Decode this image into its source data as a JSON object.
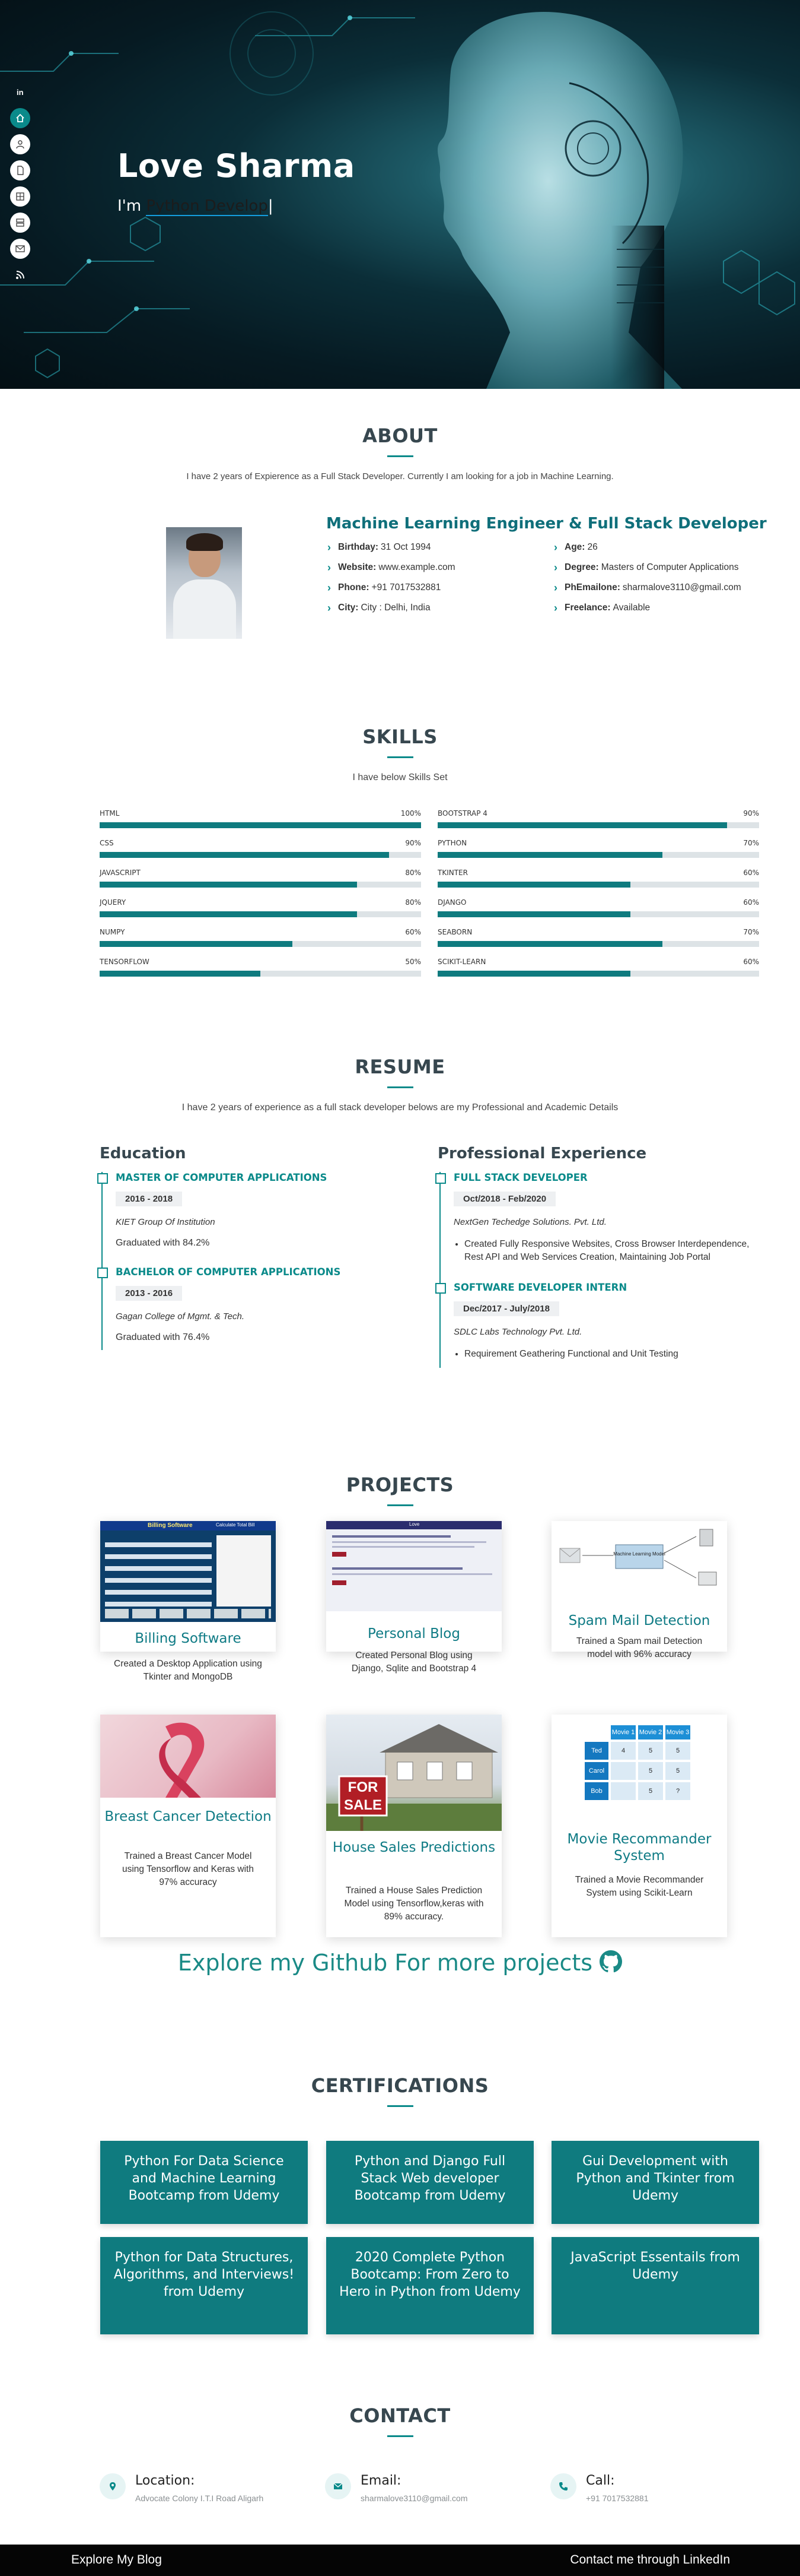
{
  "hero": {
    "name": "Love Sharma",
    "typed_prefix": "I'm",
    "typed_role": "Python Develop",
    "cursor": "|"
  },
  "nav": {
    "items": [
      {
        "icon": "linkedin-icon",
        "label": "in"
      },
      {
        "icon": "home-icon"
      },
      {
        "icon": "user-icon"
      },
      {
        "icon": "file-icon"
      },
      {
        "icon": "book-icon"
      },
      {
        "icon": "server-icon"
      },
      {
        "icon": "envelope-icon"
      },
      {
        "icon": "rss-icon"
      }
    ]
  },
  "about": {
    "title": "ABOUT",
    "intro": "I have 2 years of Expierence as a Full Stack Developer. Currently I am looking for a job in Machine Learning.",
    "role": "Machine Learning Engineer & Full Stack Developer",
    "left": [
      {
        "label": "Birthday:",
        "value": "31 Oct 1994"
      },
      {
        "label": "Website:",
        "value": "www.example.com"
      },
      {
        "label": "Phone:",
        "value": "+91 7017532881"
      },
      {
        "label": "City:",
        "value": "City : Delhi, India"
      }
    ],
    "right": [
      {
        "label": "Age:",
        "value": "26"
      },
      {
        "label": "Degree:",
        "value": "Masters of Computer Applications"
      },
      {
        "label": "PhEmailone:",
        "value": "sharmalove3110@gmail.com"
      },
      {
        "label": "Freelance:",
        "value": "Available"
      }
    ]
  },
  "skills": {
    "title": "SKILLS",
    "subtitle": "I have below Skills Set",
    "left": [
      {
        "name": "HTML",
        "pct": "100%",
        "value": 100
      },
      {
        "name": "CSS",
        "pct": "90%",
        "value": 90
      },
      {
        "name": "JAVASCRIPT",
        "pct": "80%",
        "value": 80
      },
      {
        "name": "JQUERY",
        "pct": "80%",
        "value": 80
      },
      {
        "name": "NUMPY",
        "pct": "60%",
        "value": 60
      },
      {
        "name": "TENSORFLOW",
        "pct": "50%",
        "value": 50
      }
    ],
    "right": [
      {
        "name": "BOOTSTRAP 4",
        "pct": "90%",
        "value": 90
      },
      {
        "name": "PYTHON",
        "pct": "70%",
        "value": 70
      },
      {
        "name": "TKINTER",
        "pct": "60%",
        "value": 60
      },
      {
        "name": "DJANGO",
        "pct": "60%",
        "value": 60
      },
      {
        "name": "SEABORN",
        "pct": "70%",
        "value": 70
      },
      {
        "name": "SCIKIT-LEARN",
        "pct": "60%",
        "value": 60
      }
    ]
  },
  "resume": {
    "title": "RESUME",
    "subtitle": "I have 2 years of experience as a full stack developer belows are my Professional and Academic Details",
    "education_title": "Education",
    "experience_title": "Professional Experience",
    "education": [
      {
        "title": "MASTER OF COMPUTER APPLICATIONS",
        "date": "2016 - 2018",
        "place": "KIET Group Of Institution",
        "note": "Graduated with 84.2%"
      },
      {
        "title": "BACHELOR OF COMPUTER APPLICATIONS",
        "date": "2013 - 2016",
        "place": "Gagan College of Mgmt. & Tech.",
        "note": "Graduated with 76.4%"
      }
    ],
    "experience": [
      {
        "title": "FULL STACK DEVELOPER",
        "date": "Oct/2018 - Feb/2020",
        "place": "NextGen Techedge Solutions. Pvt. Ltd.",
        "bullets": [
          "Created Fully Responsive Websites, Cross Browser Interdependence, Rest API and Web Services Creation, Maintaining Job Portal"
        ]
      },
      {
        "title": "SOFTWARE DEVELOPER INTERN",
        "date": "Dec/2017 - July/2018",
        "place": "SDLC Labs Technology Pvt. Ltd.",
        "bullets": [
          "Requirement Geathering Functional and Unit Testing"
        ]
      }
    ]
  },
  "projects": {
    "title": "PROJECTS",
    "items": [
      {
        "title": "Billing Software",
        "desc": "Created a Desktop Application using Tkinter and MongoDB",
        "thumb": "billing-thumb"
      },
      {
        "title": "Personal Blog",
        "desc": "Created Personal Blog using Django, Sqlite and Bootstrap 4",
        "thumb": "blog-thumb"
      },
      {
        "title": "Spam Mail Detection",
        "desc": "Trained a Spam mail Detection model with 96% accuracy",
        "thumb": "spam-thumb"
      },
      {
        "title": "Breast Cancer Detection",
        "desc": "Trained a Breast Cancer Model using Tensorflow and Keras with 97% accuracy",
        "thumb": "ribbon-thumb"
      },
      {
        "title": "House Sales Predictions",
        "desc": "Trained a House Sales Prediction Model using Tensorflow,keras with 89% accuracy.",
        "thumb": "house-thumb"
      },
      {
        "title": "Movie Recommander System",
        "desc": "Trained a Movie Recommander System using Scikit-Learn",
        "thumb": "movie-thumb"
      }
    ],
    "billing_thumb": {
      "title": "Billing Software",
      "right_title": "Calculate Total Bill"
    },
    "blog_thumb": {
      "header": "Love"
    },
    "house_thumb": {
      "sign_top": "FOR",
      "sign_bottom": "SALE"
    },
    "movie_thumb": {
      "headers": [
        "Movie 1",
        "Movie 2",
        "Movie 3"
      ],
      "rows": [
        {
          "name": "Ted",
          "cells": [
            "4",
            "5",
            "5"
          ]
        },
        {
          "name": "Carol",
          "cells": [
            "",
            "5",
            "5"
          ]
        },
        {
          "name": "Bob",
          "cells": [
            "",
            "5",
            "?"
          ]
        }
      ]
    },
    "spam_thumb": {
      "box": "Machine Learning Model"
    },
    "github_cta": "Explore my Github For more projects"
  },
  "certifications": {
    "title": "CERTIFICATIONS",
    "items": [
      "Python For Data Science and Machine Learning Bootcamp from Udemy",
      "Python and Django Full Stack Web developer Bootcamp from Udemy",
      "Gui Development with Python and Tkinter from Udemy",
      "Python for Data Structures, Algorithms, and Interviews! from Udemy",
      "2020 Complete Python Bootcamp: From Zero to Hero in Python from Udemy",
      "JavaScript Essentails from Udemy"
    ]
  },
  "contact": {
    "title": "CONTACT",
    "location_label": "Location:",
    "location_value": "Advocate Colony I.T.I Road Aligarh",
    "email_label": "Email:",
    "email_value": "sharmalove3110@gmail.com",
    "call_label": "Call:",
    "call_value": "+91 7017532881"
  },
  "footer": {
    "left": "Explore My Blog",
    "right": "Contact me through LinkedIn"
  },
  "colors": {
    "accent": "#0a8a8a",
    "cert_bg": "#0f7b7f",
    "footer_bg": "#050505"
  }
}
